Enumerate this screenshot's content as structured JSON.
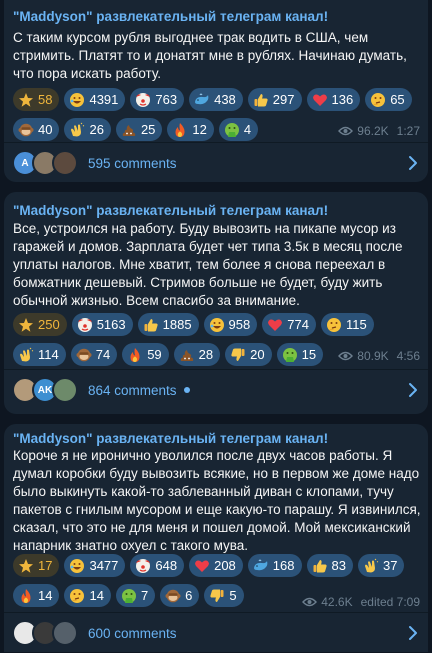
{
  "colors": {
    "bg": "#0e1621",
    "card": "#182533",
    "accent": "#6ab3f3",
    "pill": "#2b5278",
    "meta": "#6d7f8f",
    "star": "#f0b63c"
  },
  "posts": [
    {
      "title": "\"Maddyson\" развлекательный телеграм канал!",
      "text": "С таким курсом рубля выгоднее трак водить в США, чем\nстримить. Платят то и донатят мне в рублях. Начинаю думать,\nчто пора искать работу.",
      "reactions": [
        [
          {
            "emoji": "star-icon",
            "count": "58"
          },
          {
            "emoji": "rofl-icon",
            "count": "4391"
          },
          {
            "emoji": "clown-icon",
            "count": "763"
          },
          {
            "emoji": "whale-icon",
            "count": "438"
          },
          {
            "emoji": "thumbs-up-icon",
            "count": "297"
          },
          {
            "emoji": "heart-icon",
            "count": "136"
          },
          {
            "emoji": "thinking-icon",
            "count": "65"
          }
        ],
        [
          {
            "emoji": "monkey-icon",
            "count": "40"
          },
          {
            "emoji": "clap-icon",
            "count": "26"
          },
          {
            "emoji": "poo-icon",
            "count": "25"
          },
          {
            "emoji": "fire-icon",
            "count": "12"
          },
          {
            "emoji": "vomit-icon",
            "count": "4"
          }
        ]
      ],
      "views": "96.2K",
      "time": "1:27",
      "comments": {
        "label": "595 comments",
        "avatars": [
          {
            "initial": "A",
            "color": "#4a8fd8"
          },
          {
            "initial": "",
            "color": "#8a7a66"
          },
          {
            "initial": "",
            "color": "#5c4a3e"
          }
        ],
        "unread": false
      }
    },
    {
      "title": "\"Maddyson\" развлекательный телеграм канал!",
      "text": "Все, устроился на работу. Буду вывозить на пикапе мусор из\nгаражей и домов. Зарплата будет чет типа 3.5к в месяц после\nуплаты налогов. Мне хватит, тем более я снова переехал в\nбомжатник дешевый. Стримов больше не будет, буду жить\nобычной жизнью. Всем спасибо за внимание.",
      "reactions": [
        [
          {
            "emoji": "star-icon",
            "count": "250"
          },
          {
            "emoji": "clown-icon",
            "count": "5163"
          },
          {
            "emoji": "thumbs-up-icon",
            "count": "1885"
          },
          {
            "emoji": "rofl-icon",
            "count": "958"
          },
          {
            "emoji": "heart-icon",
            "count": "774"
          },
          {
            "emoji": "thinking-icon",
            "count": "115"
          }
        ],
        [
          {
            "emoji": "clap-icon",
            "count": "114"
          },
          {
            "emoji": "monkey-icon",
            "count": "74"
          },
          {
            "emoji": "fire-icon",
            "count": "59"
          },
          {
            "emoji": "poo-icon",
            "count": "28"
          },
          {
            "emoji": "thumbs-down-icon",
            "count": "20"
          },
          {
            "emoji": "vomit-icon",
            "count": "15"
          }
        ]
      ],
      "views": "80.9K",
      "time": "4:56",
      "comments": {
        "label": "864 comments",
        "avatars": [
          {
            "initial": "",
            "color": "#b39a7a"
          },
          {
            "initial": "AK",
            "color": "#3d8fd1"
          },
          {
            "initial": "",
            "color": "#6d8a6a"
          }
        ],
        "unread": true
      }
    },
    {
      "title": "\"Maddyson\" развлекательный телеграм канал!",
      "text": "Короче я не иронично уволился после двух часов работы. Я\nдумал коробки буду вывозить всякие, но в первом же доме надо\nбыло выкинуть какой-то заблеванный диван с клопами, тучу\nпакетов с гнилым мусором и еще какую-то парашу. Я извинился,\nсказал, что это не для меня и пошел домой. Мой мексиканский\nнапарник знатно охуел с такого мува.",
      "reactions": [
        [
          {
            "emoji": "star-icon",
            "count": "17"
          },
          {
            "emoji": "rofl-icon",
            "count": "3477"
          },
          {
            "emoji": "clown-icon",
            "count": "648"
          },
          {
            "emoji": "heart-icon",
            "count": "208"
          },
          {
            "emoji": "whale-icon",
            "count": "168"
          },
          {
            "emoji": "thumbs-up-icon",
            "count": "83"
          },
          {
            "emoji": "clap-icon",
            "count": "37"
          }
        ],
        [
          {
            "emoji": "fire-icon",
            "count": "14"
          },
          {
            "emoji": "thinking-icon",
            "count": "14"
          },
          {
            "emoji": "vomit-icon",
            "count": "7"
          },
          {
            "emoji": "monkey-icon",
            "count": "6"
          },
          {
            "emoji": "thumbs-down-icon",
            "count": "5"
          }
        ]
      ],
      "views": "42.6K",
      "time": "edited 7:09",
      "comments": {
        "label": "600 comments",
        "avatars": [
          {
            "initial": "",
            "color": "#e8e8e8"
          },
          {
            "initial": "",
            "color": "#3a3a3a"
          },
          {
            "initial": "",
            "color": "#55606a"
          }
        ],
        "unread": false
      }
    }
  ]
}
